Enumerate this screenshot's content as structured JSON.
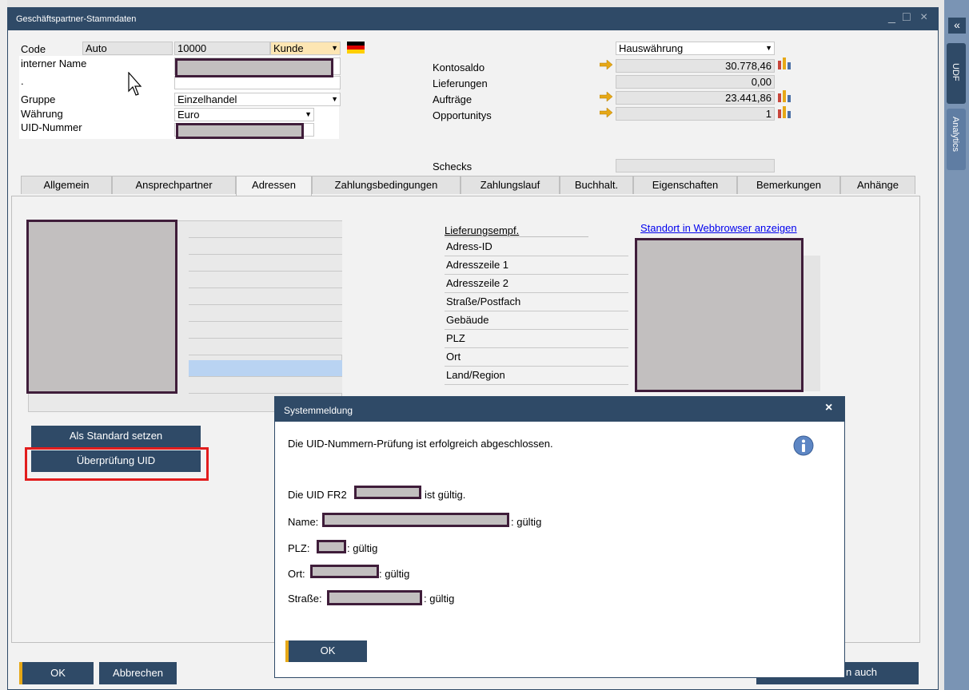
{
  "window": {
    "title": "Geschäftspartner-Stammdaten",
    "minimize": "_",
    "maximize": "□",
    "close": "×"
  },
  "header": {
    "code_label": "Code",
    "code_auto": "Auto",
    "code_value": "10000",
    "type_value": "Kunde",
    "internal_name_label": "interner Name",
    "dot_label": ".",
    "group_label": "Gruppe",
    "group_value": "Einzelhandel",
    "currency_label": "Währung",
    "currency_value": "Euro",
    "uid_label": "UID-Nummer",
    "house_currency": "Hauswährung",
    "balance_label": "Kontosaldo",
    "balance_value": "30.778,46",
    "deliveries_label": "Lieferungen",
    "deliveries_value": "0,00",
    "orders_label": "Aufträge",
    "orders_value": "23.441,86",
    "opportunities_label": "Opportunitys",
    "opportunities_value": "1",
    "checks_label": "Schecks"
  },
  "tabs": [
    {
      "label": "Allgemein"
    },
    {
      "label": "Ansprechpartner"
    },
    {
      "label": "Adressen"
    },
    {
      "label": "Zahlungsbedingungen"
    },
    {
      "label": "Zahlungslauf"
    },
    {
      "label": "Buchhalt."
    },
    {
      "label": "Eigenschaften"
    },
    {
      "label": "Bemerkungen"
    },
    {
      "label": "Anhänge"
    }
  ],
  "address": {
    "set_default": "Als Standard setzen",
    "check_uid": "Überprüfung UID",
    "ship_to_header": "Lieferungsempf.",
    "map_link": "Standort in Webbrowser anzeigen",
    "fields": [
      "Adress-ID",
      "Adresszeile 1",
      "Adresszeile 2",
      "Straße/Postfach",
      "Gebäude",
      "PLZ",
      "Ort",
      "Land/Region"
    ]
  },
  "footer": {
    "ok": "OK",
    "cancel": "Abbrechen",
    "also": "n auch"
  },
  "sidebar": {
    "udf": "UDF",
    "analytics": "Analytics",
    "collapse": "«"
  },
  "dialog": {
    "title": "Systemmeldung",
    "close": "×",
    "message": "Die UID-Nummern-Prüfung ist erfolgreich abgeschlossen.",
    "uid_prefix": "Die UID FR2",
    "uid_suffix": "ist gültig.",
    "name_label": "Name:",
    "plz_label": "PLZ:",
    "ort_label": "Ort:",
    "street_label": "Straße:",
    "valid": ": gültig",
    "ok": "OK"
  },
  "colors": {
    "titlebar": "#2f4a67",
    "accent": "#e6a817",
    "highlight": "#e21d1d",
    "link": "#0000ee",
    "selected_row": "#b9d3f2"
  }
}
